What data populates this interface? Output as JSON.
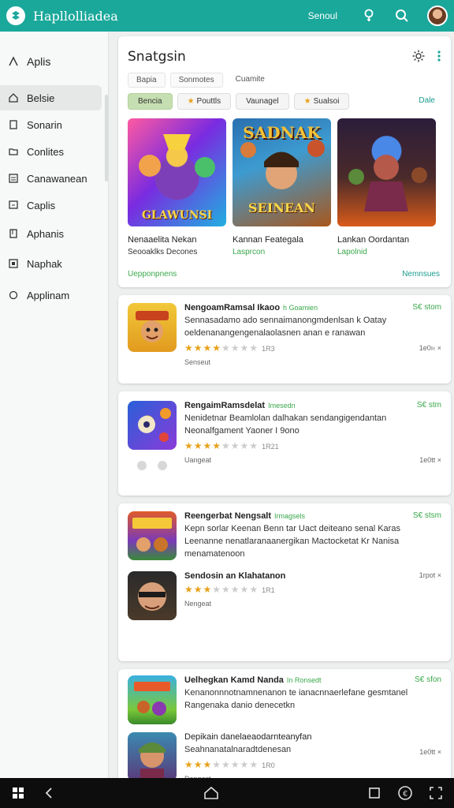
{
  "topbar": {
    "title": "Hapllolliadea",
    "account_label": "Senoul",
    "icons": [
      "bulb-icon",
      "search-icon",
      "avatar"
    ]
  },
  "sidebar": {
    "heading": "Aplis",
    "items": [
      {
        "label": "Belsie",
        "icon": "home-icon",
        "active": true
      },
      {
        "label": "Sonarin",
        "icon": "document-icon"
      },
      {
        "label": "Conlites",
        "icon": "folder-icon"
      },
      {
        "label": "Canawanean",
        "icon": "grid-icon"
      },
      {
        "label": "Caplis",
        "icon": "chat-icon"
      },
      {
        "label": "Aphanis",
        "icon": "book-icon"
      },
      {
        "label": "Naphak",
        "icon": "media-icon"
      },
      {
        "label": "Applinam",
        "icon": "settings-icon"
      }
    ]
  },
  "featured": {
    "title": "Snatgsin",
    "tabs": [
      "Bapia",
      "Sonmotes",
      "Cuamite"
    ],
    "chips": [
      {
        "label": "Bencia",
        "star": false,
        "active": true
      },
      {
        "label": "Pouttls",
        "star": true
      },
      {
        "label": "Vaunagel",
        "star": false
      },
      {
        "label": "Sualsoi",
        "star": true
      }
    ],
    "see_all": "Dale",
    "tiles": [
      {
        "overlay": "GLAWUNSI",
        "name": "Nenaaelita Nekan",
        "sub": "Seooaklks Decones",
        "sub_style": "dark"
      },
      {
        "top": "SADNAK",
        "overlay": "SEINEAN",
        "name": "Kannan Feategala",
        "sub": "Lasprcon",
        "sub_style": "green"
      },
      {
        "overlay": "",
        "name": "Lankan Oordantan",
        "sub": "Lapolnid",
        "sub_style": "green"
      }
    ],
    "footer_left": "Uepponpnens",
    "footer_right": "Nemnsues"
  },
  "apps": [
    {
      "name": "NengoamRamsal Ikaoo",
      "tag": "h Goamien",
      "price": "S€ stom",
      "desc": "Sennasadamo ado sennaimanongmdenlsan k Oatay oeldenanangengenalaolasnen anan e ranawan",
      "rating": 3.5,
      "count": "1R3",
      "size": "1e0ı‹ ×",
      "category": "Senseut"
    },
    {
      "name": "RengaimRamsdelat",
      "tag": "Imesedn",
      "price": "S€ stm",
      "desc": "Nenidetnar Beamlolan dalhakan sendangigendantan Neonalfgament Yaoner I 9ono",
      "rating": 4,
      "count": "1R21",
      "size": "1e0tt ×",
      "category": "Uangeat"
    },
    {
      "name": "Reengerbat Nengsalt",
      "tag": "Irmagsels",
      "price": "S€ stsm",
      "desc": "Kepn sorlar Keenan Benn tar Uact deiteano senal Karas Leenanne nenatlaranaanergikan Mactocketat Kr Nanisa menamatenoon",
      "rating": 0,
      "count": "",
      "size": "",
      "category": ""
    },
    {
      "name": "Sendosin an Klahatanon",
      "tag": "",
      "price": "",
      "desc": "",
      "rating": 3,
      "count": "1R1",
      "size": "1rpot ×",
      "category": "Nengeat"
    },
    {
      "name": "Uelhegkan Kamd Nanda",
      "tag": "In Ronsedt",
      "price": "S€ sfon",
      "desc": "Kenanonnnotnamnenanon te ianacnnaerlefane gesmtanel Rangenaka danio denecetkn",
      "rating": 0,
      "count": "",
      "size": "",
      "category": ""
    },
    {
      "name": "Depikain danelaeaodarnteanyfan",
      "tag": "",
      "price": "",
      "desc": "Seahnanatalnaradtdenesan",
      "rating": 3,
      "count": "1R0",
      "size": "1e0tt ×",
      "category": "Dangest"
    }
  ]
}
